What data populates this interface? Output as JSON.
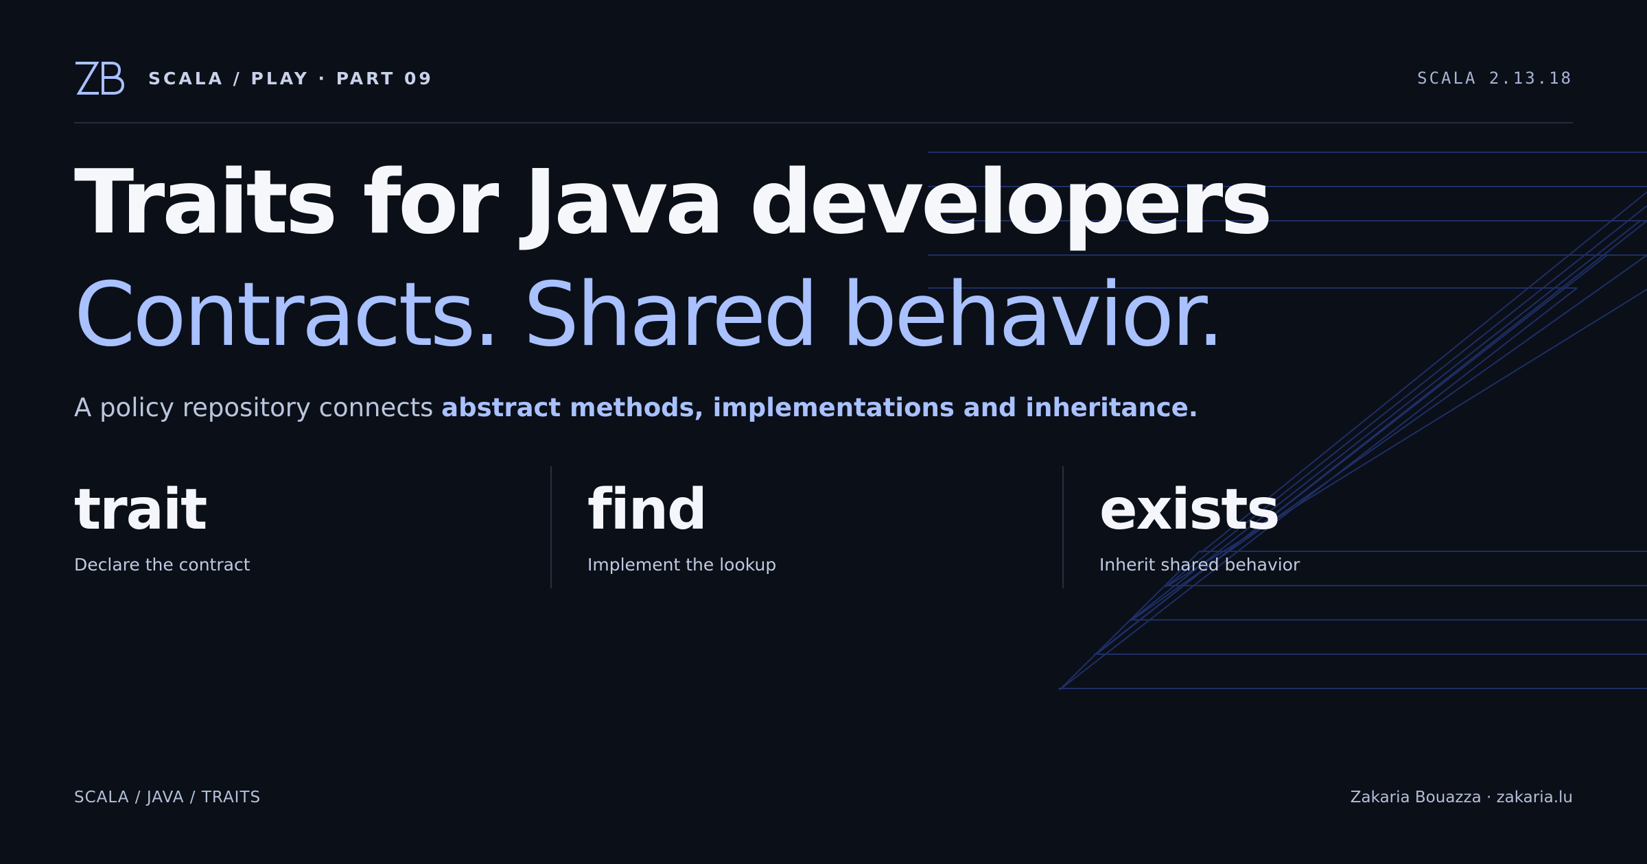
{
  "header": {
    "logo_text": "ZB",
    "breadcrumb": "SCALA / PLAY · PART 09",
    "version": "SCALA 2.13.18"
  },
  "hero": {
    "title": "Traits for Java developers",
    "subtitle": "Contracts. Shared behavior.",
    "lede_prefix": "A policy repository connects ",
    "lede_highlight": "abstract methods, implementations and inheritance."
  },
  "features": [
    {
      "term": "trait",
      "description": "Declare the contract"
    },
    {
      "term": "find",
      "description": "Implement the lookup"
    },
    {
      "term": "exists",
      "description": "Inherit shared behavior"
    }
  ],
  "footer": {
    "left": "SCALA / JAVA / TRAITS",
    "right": "Zakaria Bouazza · zakaria.lu"
  },
  "colors": {
    "background": "#0b0f18",
    "text_primary": "#f6f7fb",
    "text_secondary": "#bac6dd",
    "accent": "#a9c1ff",
    "line": "#1e2f66",
    "divider": "#252d3c"
  }
}
